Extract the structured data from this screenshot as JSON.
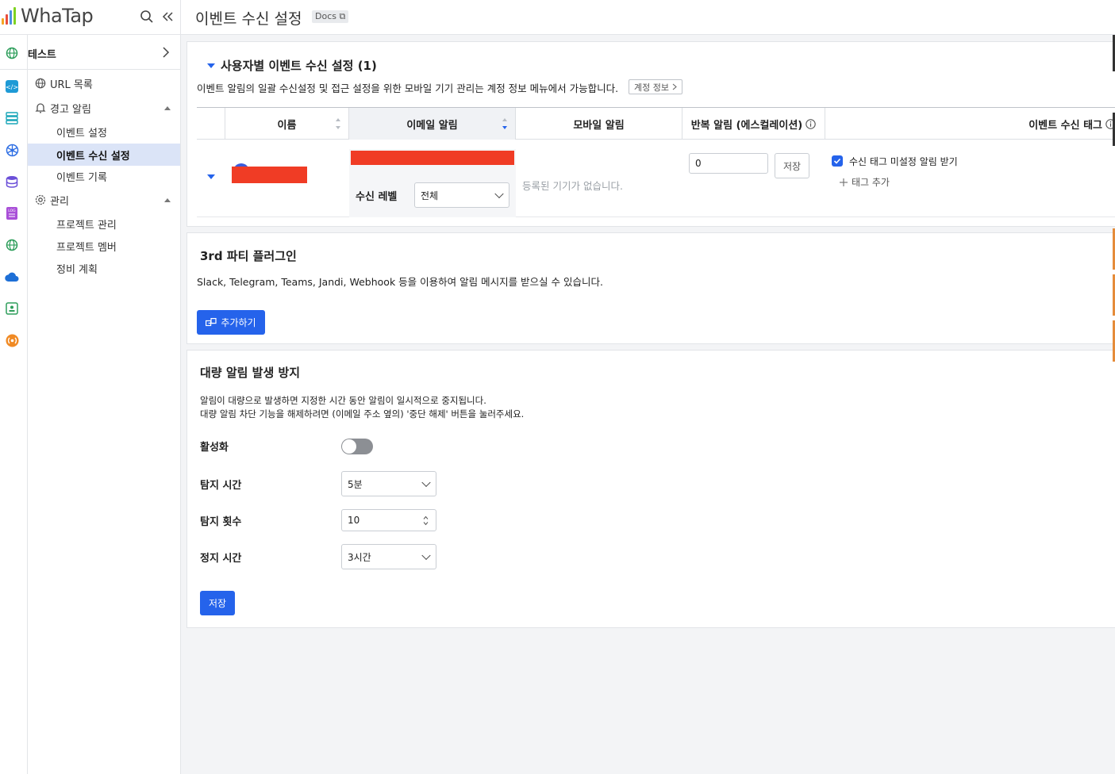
{
  "app": {
    "logo_text": "WhaTap"
  },
  "header": {
    "title": "이벤트 수신 설정",
    "docs_label": "Docs"
  },
  "sidebar": {
    "project_name": "테스트",
    "items": [
      {
        "label": "URL 목록"
      },
      {
        "label": "경고 알림"
      },
      {
        "label": "이벤트 설정"
      },
      {
        "label": "이벤트 수신 설정"
      },
      {
        "label": "이벤트 기록"
      },
      {
        "label": "관리"
      },
      {
        "label": "프로젝트 관리"
      },
      {
        "label": "프로젝트 멤버"
      },
      {
        "label": "정비 계획"
      }
    ]
  },
  "user_settings": {
    "title": "사용자별 이벤트 수신 설정 (1)",
    "description": "이벤트 알림의 일괄 수신설정 및 접근 설정을 위한 모바일 기기 관리는 계정 정보 메뉴에서 가능합니다.",
    "account_button": "계정 정보",
    "columns": [
      "이름",
      "이메일 알림",
      "모바일 알림",
      "반복 알림 (에스컬레이션)",
      "이벤트 수신 태그"
    ],
    "row": {
      "receive_level_label": "수신 레벨",
      "receive_level_value": "전체",
      "mobile_text": "등록된 기기가 없습니다.",
      "repeat_value": "0",
      "save_label": "저장",
      "tag_checkbox_label": "수신 태그 미설정 알림 받기",
      "tag_checked": true,
      "add_tag_label": "태그 추가"
    }
  },
  "plugin": {
    "title": "3rd 파티 플러그인",
    "description": "Slack, Telegram, Teams, Jandi, Webhook 등을 이용하여 알림 메시지를 받으실 수 있습니다.",
    "add_label": "추가하기"
  },
  "bulk": {
    "title": "대량 알림 발생 방지",
    "desc1": "알림이 대량으로 발생하면 지정한 시간 동안 알림이 일시적으로 중지됩니다.",
    "desc2": "대량 알림 차단 기능을 해제하려면 (이메일 주소 옆의) '중단 해제' 버튼을 눌러주세요.",
    "enable_label": "활성화",
    "enabled": false,
    "detect_time_label": "탐지 시간",
    "detect_time_value": "5분",
    "detect_count_label": "탐지 횟수",
    "detect_count_value": "10",
    "stop_time_label": "정지 시간",
    "stop_time_value": "3시간",
    "save_label": "저장"
  },
  "colors": {
    "accent": "#2563eb",
    "active_bg": "#dbe4f7",
    "redaction": "#f03c25"
  }
}
